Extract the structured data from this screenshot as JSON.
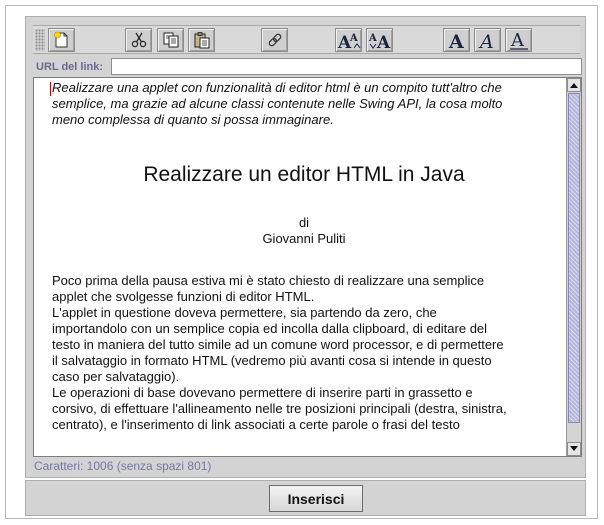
{
  "toolbar": {
    "buttons": [
      {
        "name": "new-document",
        "icon": "new-document-icon"
      },
      {
        "name": "cut",
        "icon": "scissors-icon"
      },
      {
        "name": "copy",
        "icon": "copy-icon"
      },
      {
        "name": "paste",
        "icon": "paste-icon"
      },
      {
        "name": "insert-link",
        "icon": "link-icon"
      },
      {
        "name": "increase-font",
        "icon": "font-size-up-icon"
      },
      {
        "name": "decrease-font",
        "icon": "font-size-down-icon"
      },
      {
        "name": "bold",
        "icon": "bold-icon"
      },
      {
        "name": "italic",
        "icon": "italic-icon"
      },
      {
        "name": "underline",
        "icon": "underline-icon"
      }
    ]
  },
  "link": {
    "label": "URL del link:",
    "value": ""
  },
  "editor": {
    "intro_lines": [
      "Realizzare una applet con funzionalità di editor html è un compito tutt'altro che",
      "semplice, ma grazie ad alcune classi contenute nelle Swing API, la cosa  molto",
      "meno complessa di quanto si possa immaginare."
    ],
    "title": "Realizzare un  editor HTML in Java",
    "byline": "di",
    "author": "Giovanni Puliti",
    "body_lines": [
      "Poco prima della pausa estiva mi è stato chiesto di realizzare una semplice",
      "applet che  svolgesse funzioni di editor HTML.",
      "L'applet in questione doveva permettere,  sia partendo da zero, che",
      "importandolo con un semplice copia ed incolla dalla clipboard, di editare del",
      "testo in maniera del tutto simile ad un comune word processor, e di permettere",
      "il salvataggio in formato HTML (vedremo più avanti cosa si intende in questo",
      "caso per salvataggio).",
      "Le operazioni di base dovevano permettere di inserire parti in grassetto e",
      "corsivo, di effettuare l'allineamento nelle tre posizioni principali (destra, sinistra,",
      "centrato), e l'inserimento di link associati a certe parole o frasi del testo"
    ]
  },
  "status": {
    "text": "Caratteri: 1006 (senza spazi 801)"
  },
  "actions": {
    "insert_label": "Inserisci"
  },
  "colors": {
    "panel": "#d3d3d3",
    "status_text": "#7677a5",
    "scroll_thumb": "#b5b8dc",
    "caret": "#d00000"
  }
}
